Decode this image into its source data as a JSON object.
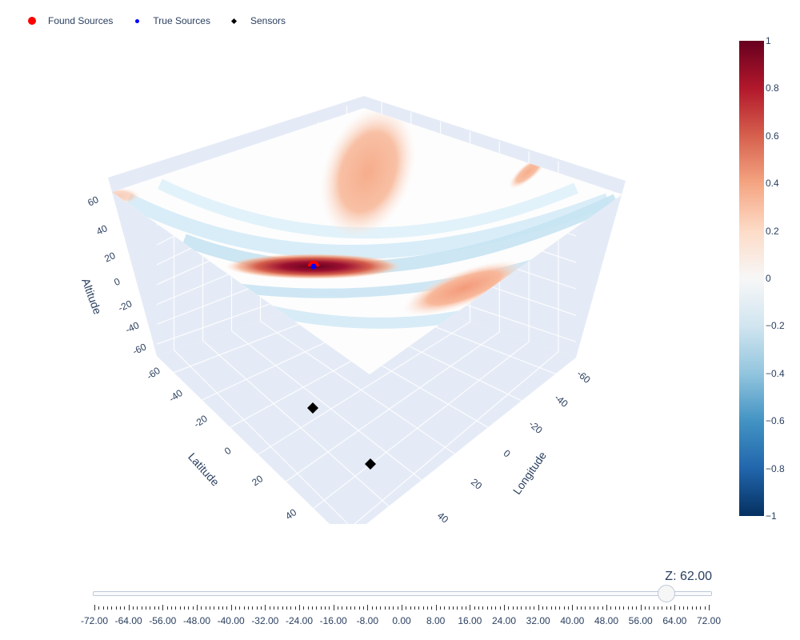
{
  "legend": {
    "items": [
      {
        "label": "Found Sources",
        "color": "#ff0000",
        "symbol": "circle"
      },
      {
        "label": "True Sources",
        "color": "#0000ff",
        "symbol": "circle-small"
      },
      {
        "label": "Sensors",
        "color": "#000000",
        "symbol": "diamond"
      }
    ]
  },
  "colorbar": {
    "colorscale": "RdBu",
    "min": -1,
    "max": 1,
    "ticks": [
      "1",
      "0.8",
      "0.6",
      "0.4",
      "0.2",
      "0",
      "−0.2",
      "−0.4",
      "−0.6",
      "−0.8",
      "−1"
    ],
    "tick_values": [
      1,
      0.8,
      0.6,
      0.4,
      0.2,
      0,
      -0.2,
      -0.4,
      -0.6,
      -0.8,
      -1
    ]
  },
  "slider": {
    "current_label": "Z: 62.00",
    "prefix": "Z: ",
    "value": 62.0,
    "min": -72.0,
    "max": 72.0,
    "step": 1,
    "labels": [
      "-72.00",
      "-64.00",
      "-56.00",
      "-48.00",
      "-40.00",
      "-32.00",
      "-24.00",
      "-16.00",
      "-8.00",
      "0.00",
      "8.00",
      "16.00",
      "24.00",
      "32.00",
      "40.00",
      "48.00",
      "56.00",
      "64.00",
      "72.00"
    ]
  },
  "chart_data": {
    "type": "scatter3d+surface-slice",
    "title": "",
    "axes": {
      "x": {
        "title": "Longitude",
        "ticks": [
          "-60",
          "-40",
          "-20",
          "0",
          "20",
          "40"
        ],
        "range": [
          -72,
          72
        ]
      },
      "y": {
        "title": "Latitude",
        "ticks": [
          "-60",
          "-40",
          "-20",
          "0",
          "20",
          "40"
        ],
        "range": [
          -72,
          72
        ]
      },
      "z": {
        "title": "Altitude",
        "ticks": [
          "60",
          "40",
          "20",
          "0",
          "-20",
          "-40",
          "-60"
        ],
        "range": [
          -72,
          72
        ]
      }
    },
    "slice": {
      "z": 62,
      "colorscale": "RdBu",
      "cmin": -1,
      "cmax": 1,
      "features": [
        {
          "kind": "peak",
          "value": 1.0,
          "description": "dark red elongated peak at found source"
        },
        {
          "kind": "lobe",
          "value": 0.35,
          "description": "orange crescent lobe upper area"
        },
        {
          "kind": "lobe",
          "value": 0.4,
          "description": "orange lobe lower right edge"
        },
        {
          "kind": "ring",
          "value": -0.2,
          "description": "light blue concentric arcs"
        }
      ]
    },
    "series": [
      {
        "name": "Found Sources",
        "type": "marker",
        "color": "#ff0000",
        "points": [
          {
            "x": 0,
            "y": 0,
            "z": 62
          }
        ]
      },
      {
        "name": "True Sources",
        "type": "marker",
        "color": "#0000ff",
        "points": [
          {
            "x": 0,
            "y": 0,
            "z": 62
          }
        ]
      },
      {
        "name": "Sensors",
        "type": "marker",
        "color": "#000000",
        "points": [
          {
            "x": -20,
            "y": 0,
            "z": -72
          },
          {
            "x": 20,
            "y": 20,
            "z": -72
          }
        ]
      }
    ]
  }
}
